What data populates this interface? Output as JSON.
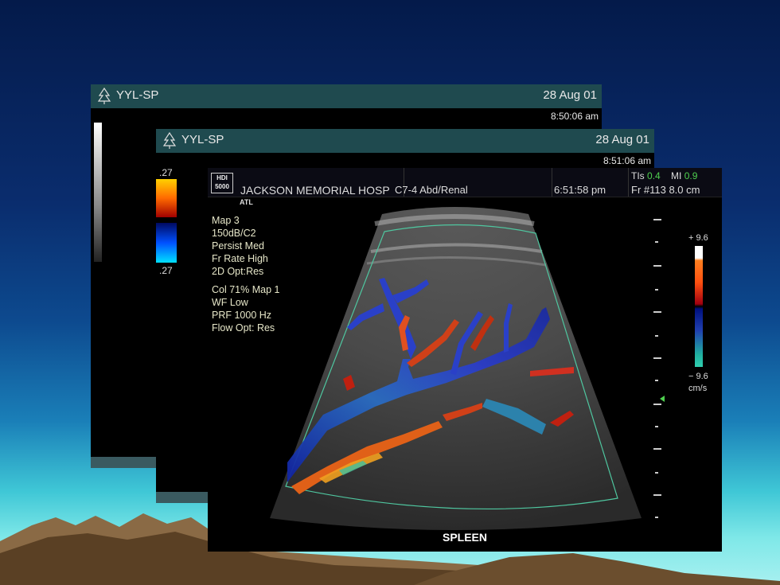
{
  "frames": {
    "back": {
      "name": "YYL-SP",
      "date": "28 Aug 01",
      "time": "8:50:06 am"
    },
    "mid": {
      "name": "YYL-SP",
      "date": "28 Aug 01",
      "time": "8:51:06 am",
      "scale_top": ".27",
      "scale_bottom": ".27"
    },
    "front": {
      "logo": "HDI 5000",
      "brand": "ATL",
      "hospital": "JACKSON MEMORIAL  HOSP",
      "probe": "C7-4 Abd/Renal",
      "clock": "6:51:58 pm",
      "tis_label": "TIs",
      "tis_value": "0.4",
      "mi_label": "MI",
      "mi_value": "0.9",
      "frame_no": "Fr #113  8.0 cm",
      "params_2d": [
        "Map 3",
        "150dB/C2",
        "Persist Med",
        "Fr Rate High",
        "2D Opt:Res"
      ],
      "params_color": [
        "Col 71%  Map 1",
        "WF Low",
        "PRF 1000  Hz",
        "Flow Opt: Res"
      ],
      "scale_max": "+ 9.6",
      "scale_min": "− 9.6",
      "scale_unit": "cm/s",
      "organ": "SPLEEN"
    }
  },
  "colors": {
    "sky_top": "#041a4a",
    "sea": "#3fc7d6",
    "titlebar": "#1f4a4f",
    "mountain": "#8a6a45"
  }
}
